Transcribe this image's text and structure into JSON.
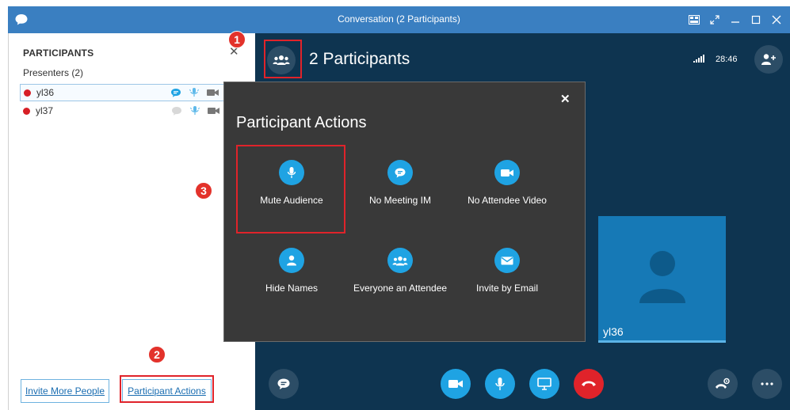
{
  "window": {
    "title": "Conversation (2 Participants)"
  },
  "left_panel": {
    "heading": "PARTICIPANTS",
    "group_label": "Presenters (2)",
    "participants": [
      {
        "name": "yl36",
        "status_color": "#d71f26",
        "im_active": true
      },
      {
        "name": "yl37",
        "status_color": "#d71f26",
        "im_active": false
      }
    ],
    "invite_button": "Invite More People",
    "actions_button": "Participant Actions"
  },
  "stage": {
    "header": "2 Participants",
    "signal_icon": "signal-bars-icon",
    "timer": "28:46",
    "video_tile_name": "yl36"
  },
  "popup": {
    "title": "Participant Actions",
    "actions": [
      {
        "label": "Mute Audience",
        "icon": "microphone-icon"
      },
      {
        "label": "No Meeting IM",
        "icon": "chat-icon"
      },
      {
        "label": "No Attendee Video",
        "icon": "video-camera-icon"
      },
      {
        "label": "Hide Names",
        "icon": "person-icon"
      },
      {
        "label": "Everyone an Attendee",
        "icon": "people-icon"
      },
      {
        "label": "Invite by Email",
        "icon": "envelope-icon"
      }
    ]
  },
  "annotations": {
    "step1": "1",
    "step2": "2",
    "step3": "3"
  },
  "colors": {
    "accent": "#1fa3e3",
    "titlebar": "#3a7fc1",
    "stage_bg": "#0e3450",
    "popup_bg": "#393939",
    "hangup": "#e0232a",
    "annotation_red": "#e0232a"
  }
}
